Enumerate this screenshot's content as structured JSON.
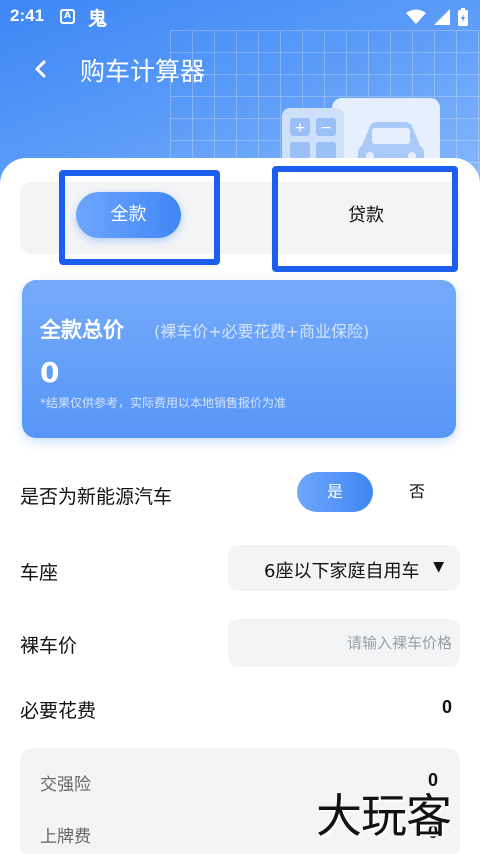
{
  "status_bar": {
    "time": "2:41",
    "app_icon_1": "A",
    "app_icon_2": "鬼"
  },
  "header": {
    "title": "购车计算器"
  },
  "icons": {
    "back": "chevron-left-icon",
    "wifi": "wifi-icon",
    "signal": "signal-icon",
    "battery": "battery-icon",
    "calculator": "calculator-icon",
    "car": "car-icon"
  },
  "tabs": {
    "full_label": "全款",
    "loan_label": "贷款"
  },
  "total_card": {
    "title": "全款总价",
    "subtitle": "(裸车价+必要花费+商业保险)",
    "amount": "0",
    "note": "*结果仅供参考，实际费用以本地销售报价为准"
  },
  "new_energy": {
    "label": "是否为新能源汽车",
    "yes": "是",
    "no": "否",
    "selected": "是"
  },
  "seats": {
    "label": "车座",
    "value": "6座以下家庭自用车"
  },
  "car_price": {
    "label": "裸车价",
    "placeholder": "请输入裸车价格",
    "value": ""
  },
  "necessary_fees": {
    "label": "必要花费",
    "value": "0",
    "items": [
      {
        "label": "交强险",
        "value": "0"
      },
      {
        "label": "上牌费",
        "value": "0"
      }
    ]
  },
  "watermark": "大玩客",
  "colors": {
    "accent": "#3f87f6",
    "highlight": "#1b5ef0"
  }
}
